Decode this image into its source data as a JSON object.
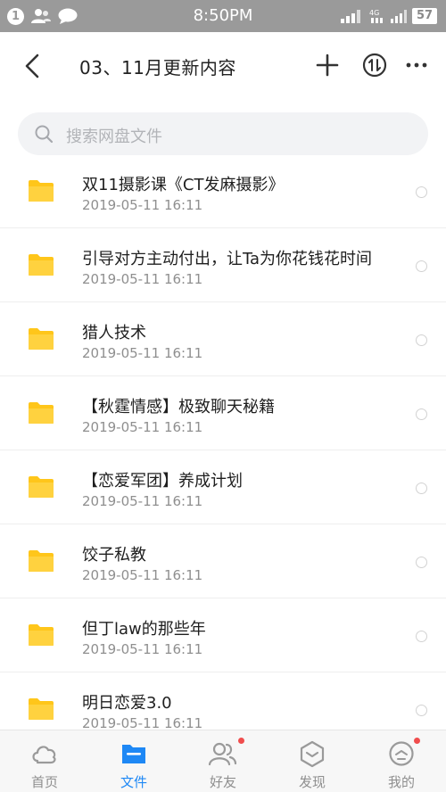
{
  "status_bar": {
    "notification_count": "1",
    "time": "8:50PM",
    "network": "4G",
    "battery": "57"
  },
  "header": {
    "title": "03、11月更新内容",
    "icons": [
      "back-arrow-icon",
      "plus-icon",
      "sort-icon",
      "more-icon"
    ]
  },
  "search": {
    "placeholder": "搜索网盘文件"
  },
  "files": [
    {
      "name": "双11摄影课《CT发麻摄影》",
      "date": "2019-05-11  16:11"
    },
    {
      "name": "引导对方主动付出，让Ta为你花钱花时间",
      "date": "2019-05-11  16:11"
    },
    {
      "name": "猎人技术",
      "date": "2019-05-11  16:11"
    },
    {
      "name": "【秋霆情感】极致聊天秘籍",
      "date": "2019-05-11  16:11"
    },
    {
      "name": "【恋爱军团】养成计划",
      "date": "2019-05-11  16:11"
    },
    {
      "name": "饺子私教",
      "date": "2019-05-11  16:11"
    },
    {
      "name": "但丁law的那些年",
      "date": "2019-05-11  16:11"
    },
    {
      "name": "明日恋爱3.0",
      "date": "2019-05-11  16:11"
    }
  ],
  "tabs": [
    {
      "label": "首页",
      "icon": "cloud-icon",
      "active": false
    },
    {
      "label": "文件",
      "icon": "folder-icon",
      "active": true
    },
    {
      "label": "好友",
      "icon": "friends-icon",
      "active": false
    },
    {
      "label": "发现",
      "icon": "discover-icon",
      "active": false
    },
    {
      "label": "我的",
      "icon": "profile-icon",
      "active": false
    }
  ],
  "colors": {
    "accent": "#1e88f5",
    "folder": "#ffc61a",
    "status_bar": "#9a9a9a",
    "notification_dot": "#f04d4d"
  }
}
